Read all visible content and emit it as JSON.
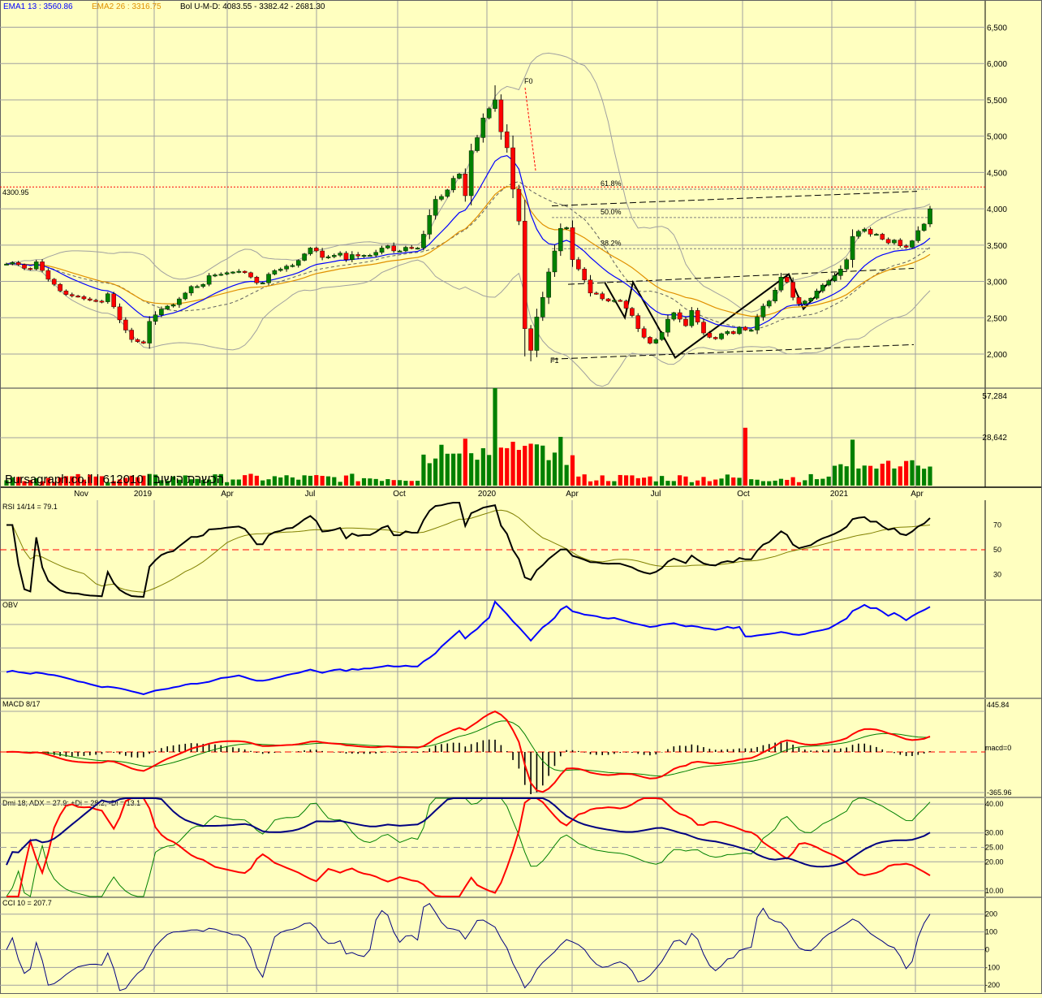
{
  "header": {
    "ema1": "EMA1 13 : 3560.86",
    "ema2": "EMA2 26 : 3316.75",
    "bol": "Bol U-M-D: 4083.55 - 3382.42 - 2681.30"
  },
  "watermark": "Bursagraph.co.il | 612010 | הכשרת הישוב",
  "colors": {
    "background": "#ffffc0",
    "up_candle": "#008000",
    "down_candle": "#ff0000",
    "ema1": "#0000ff",
    "ema2": "#e09000",
    "bollinger": "#a0a0a0",
    "grid": "#a0a0a0",
    "rsi_line": "#000000",
    "rsi_signal": "#808000",
    "obv_line": "#0000ff",
    "macd_line": "#ff0000",
    "macd_signal": "#008000",
    "adx": "#000080",
    "plus_di": "#008000",
    "minus_di": "#ff0000",
    "cci": "#000080"
  },
  "chart_data": [
    {
      "type": "candlestick",
      "price_axis_labels": [
        "6,500",
        "6,000",
        "5,500",
        "5,000",
        "4,500",
        "4,000",
        "3,500",
        "3,000",
        "2,500",
        "2,000"
      ],
      "ylim": [
        1550,
        6650
      ],
      "annotations": {
        "level_line": "4300.95",
        "fib_labels": [
          "61.8%",
          "50.0%",
          "38.2%"
        ],
        "pivot_labels": [
          "F0",
          "F1"
        ]
      },
      "volume_axis_labels": [
        "57,284",
        "28,642"
      ],
      "time_labels": [
        "Nov",
        "2019",
        "Apr",
        "Jul",
        "Oct",
        "2020",
        "Apr",
        "Jul",
        "Oct",
        "2021",
        "Apr"
      ],
      "close": [
        3240,
        3260,
        3230,
        3180,
        3170,
        3270,
        3150,
        3030,
        2960,
        2870,
        2820,
        2800,
        2790,
        2760,
        2740,
        2730,
        2720,
        2830,
        2650,
        2470,
        2330,
        2200,
        2170,
        2150,
        2450,
        2540,
        2620,
        2660,
        2680,
        2760,
        2840,
        2930,
        2930,
        2960,
        3080,
        3090,
        3100,
        3120,
        3130,
        3140,
        3120,
        3060,
        2980,
        2980,
        3100,
        3150,
        3170,
        3210,
        3220,
        3290,
        3380,
        3460,
        3420,
        3330,
        3340,
        3360,
        3390,
        3300,
        3370,
        3350,
        3360,
        3360,
        3400,
        3460,
        3490,
        3420,
        3420,
        3470,
        3460,
        3460,
        3650,
        3910,
        4130,
        4170,
        4260,
        4420,
        4480,
        4180,
        4800,
        4980,
        5250,
        5380,
        5500,
        5060,
        4840,
        4270,
        3830,
        2350,
        2050,
        2510,
        2780,
        3130,
        3420,
        3730,
        3740,
        3300,
        3170,
        3020,
        2840,
        2830,
        2760,
        2730,
        2740,
        2730,
        2630,
        2530,
        2350,
        2230,
        2150,
        2200,
        2300,
        2480,
        2570,
        2480,
        2390,
        2600,
        2440,
        2290,
        2230,
        2210,
        2280,
        2310,
        2280,
        2370,
        2330,
        2330,
        2510,
        2660,
        2730,
        2880,
        3060,
        2990,
        2780,
        2690,
        2730,
        2770,
        2870,
        2950,
        3010,
        3080,
        3170,
        3300,
        3620,
        3690,
        3720,
        3650,
        3650,
        3580,
        3530,
        3570,
        3490,
        3470,
        3560,
        3700,
        3790,
        4000
      ]
    },
    {
      "type": "line",
      "name": "RSI 14/14 = 79.1",
      "y_axis_labels": [
        "70",
        "50",
        "30"
      ],
      "ylim": [
        10,
        90
      ]
    },
    {
      "type": "line",
      "name": "OBV"
    },
    {
      "type": "line",
      "name": "MACD 8/17",
      "y_axis_labels": [
        "445.84",
        "macd=0",
        "-365.96"
      ],
      "ylim": [
        -365.96,
        445.84
      ]
    },
    {
      "type": "line",
      "name": "Dmi 18; ADX = 27.9; +Di = 28.2; -Di = 13.1",
      "y_axis_labels": [
        "40.00",
        "30.00",
        "25.00",
        "20.00",
        "10.00"
      ],
      "ylim": [
        8,
        42
      ]
    },
    {
      "type": "line",
      "name": "CCI 10 = 207.7",
      "y_axis_labels": [
        "200",
        "100",
        "0",
        "-100",
        "-200"
      ],
      "ylim": [
        -240,
        290
      ]
    }
  ]
}
